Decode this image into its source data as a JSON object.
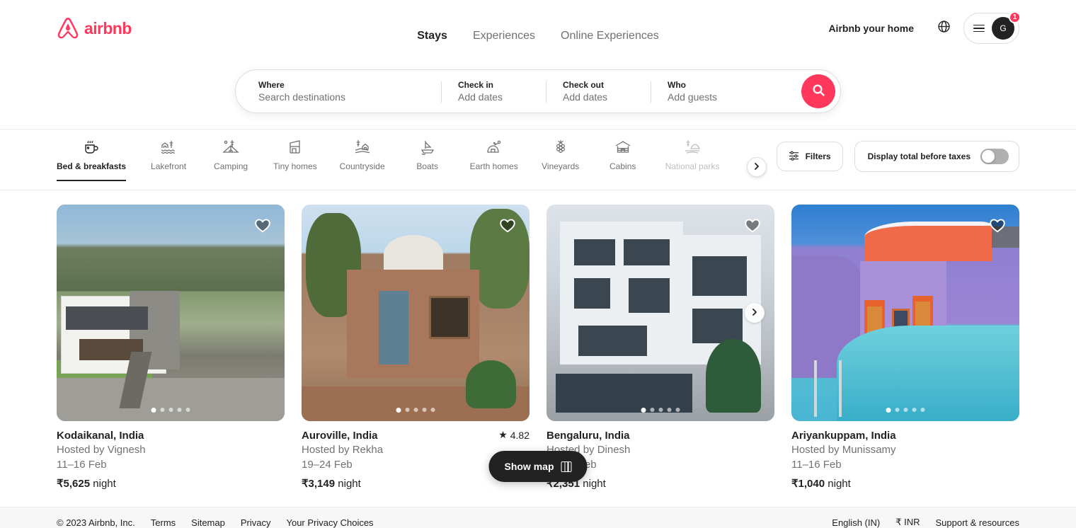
{
  "header": {
    "brand": "airbnb",
    "nav_tabs": [
      {
        "label": "Stays",
        "active": true
      },
      {
        "label": "Experiences",
        "active": false
      },
      {
        "label": "Online Experiences",
        "active": false
      }
    ],
    "host_link": "Airbnb your home",
    "globe_icon": "globe-icon",
    "menu_icon": "hamburger-icon",
    "avatar_initial": "G",
    "notification_count": "1"
  },
  "search": {
    "where_label": "Where",
    "where_placeholder": "Search destinations",
    "checkin_label": "Check in",
    "checkin_value": "Add dates",
    "checkout_label": "Check out",
    "checkout_value": "Add dates",
    "who_label": "Who",
    "who_value": "Add guests",
    "search_icon": "search-icon",
    "accent_color": "#FF385C"
  },
  "categories": [
    {
      "label": "Bed & breakfasts",
      "icon": "teacup-icon",
      "active": true
    },
    {
      "label": "Lakefront",
      "icon": "lakefront-icon",
      "active": false
    },
    {
      "label": "Camping",
      "icon": "tent-icon",
      "active": false
    },
    {
      "label": "Tiny homes",
      "icon": "tiny-home-icon",
      "active": false
    },
    {
      "label": "Countryside",
      "icon": "countryside-icon",
      "active": false
    },
    {
      "label": "Boats",
      "icon": "boat-icon",
      "active": false
    },
    {
      "label": "Earth homes",
      "icon": "earth-home-icon",
      "active": false
    },
    {
      "label": "Vineyards",
      "icon": "grapes-icon",
      "active": false
    },
    {
      "label": "Cabins",
      "icon": "cabin-icon",
      "active": false
    },
    {
      "label": "National parks",
      "icon": "national-park-icon",
      "active": false
    }
  ],
  "toolbar": {
    "next_arrow_icon": "chevron-right-icon",
    "filters_label": "Filters",
    "filters_icon": "sliders-icon",
    "taxes_label": "Display total before taxes",
    "taxes_toggle_on": false
  },
  "listings": [
    {
      "title": "Kodaikanal, India",
      "host": "Hosted by Vignesh",
      "dates": "11–16 Feb",
      "price": "₹5,625",
      "price_unit": "night",
      "rating": "",
      "dot_count": 5,
      "active_dot": 0,
      "has_next_arrow": false
    },
    {
      "title": "Auroville, India",
      "host": "Hosted by Rekha",
      "dates": "19–24 Feb",
      "price": "₹3,149",
      "price_unit": "night",
      "rating": "4.82",
      "dot_count": 5,
      "active_dot": 0,
      "has_next_arrow": false
    },
    {
      "title": "Bengaluru, India",
      "host": "Hosted by Dinesh",
      "dates": "11–16 Feb",
      "price": "₹2,351",
      "price_unit": "night",
      "rating": "",
      "dot_count": 5,
      "active_dot": 0,
      "has_next_arrow": true
    },
    {
      "title": "Ariyankuppam, India",
      "host": "Hosted by Munissamy",
      "dates": "11–16 Feb",
      "price": "₹1,040",
      "price_unit": "night",
      "rating": "",
      "dot_count": 5,
      "active_dot": 0,
      "has_next_arrow": false
    }
  ],
  "show_map": {
    "label": "Show map",
    "icon": "map-icon"
  },
  "footer": {
    "left_items": [
      "© 2023 Airbnb, Inc.",
      "Terms",
      "Sitemap",
      "Privacy",
      "Your Privacy Choices"
    ],
    "right_items": [
      "English (IN)",
      "₹ INR",
      "Support & resources"
    ]
  }
}
